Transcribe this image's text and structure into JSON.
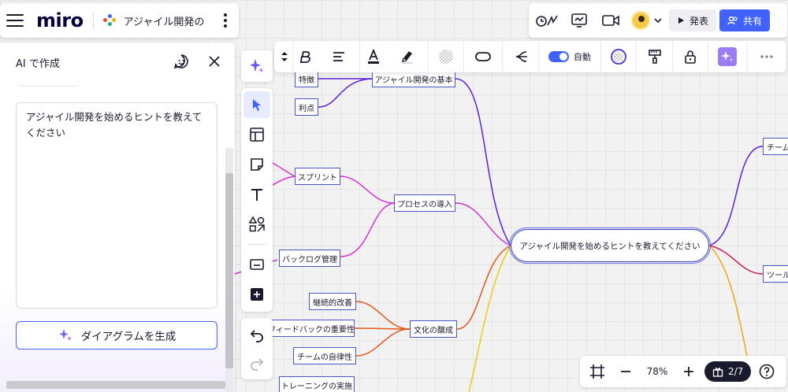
{
  "app": {
    "logo": "miro",
    "board_title": "アジャイル開発の"
  },
  "topbar": {
    "present_label": "発表",
    "share_label": "共有"
  },
  "ai_panel": {
    "title": "AI で作成",
    "prompt_value": "アジャイル開発を始めるヒントを教えてください",
    "generate_label": "ダイアグラムを生成"
  },
  "context_toolbar": {
    "auto_label": "自動"
  },
  "zoom": {
    "level": "78%",
    "page": "2/7"
  },
  "mindmap": {
    "root": "アジャイル開発を始めるヒントを教えてください",
    "nodes": {
      "feature": "特徴",
      "basics": "アジャイル開発の基本",
      "benefit": "利点",
      "sprint": "スプリント",
      "process": "プロセスの導入",
      "backlog": "バックログ管理",
      "kaizen": "継続的改善",
      "feedback": "フィードバックの重要性",
      "culture": "文化の醸成",
      "autonomy": "チームの自律性",
      "training": "トレーニングの実施",
      "team_right": "チーム",
      "tool_right": "ツール"
    }
  },
  "colors": {
    "accent": "#4262ff",
    "purple_branch": "#5b21d9",
    "magenta_branch": "#d62fd6",
    "orange_branch": "#e2581b",
    "yellow_branch": "#f2c80f",
    "pink_branch": "#d4145a"
  }
}
